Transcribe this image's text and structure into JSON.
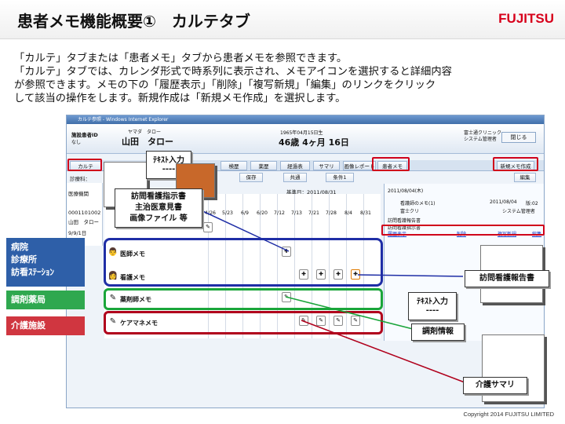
{
  "slide": {
    "title": "患者メモ機能概要①　カルテタブ",
    "logo": "FUJITSU",
    "intro": [
      "「カルテ」タブまたは「患者メモ」タブから患者メモを参照できます。",
      "「カルテ」タブでは、カレンダ形式で時系列に表示され、メモアイコンを選択すると詳細内容",
      "が参照できます。メモの下の「履歴表示」「削除」「複写新規」「編集」のリンクをクリック",
      "して該当の操作をします。新規作成は「新規メモ作成」を選択します。"
    ],
    "copyright": "Copyright 2014 FUJITSU LIMITED"
  },
  "window": {
    "title": "カルテ参照 - Windows Internet Explorer",
    "patient_id_label": "施設患者ID",
    "patient_id_value": "なし",
    "name_kana": "ヤマダ　タロー",
    "name": "山田　タロー",
    "birth": "1965年04月15日生",
    "age": "46歳 4ヶ月 16日",
    "clinic_line1": "富士通クリニック",
    "clinic_line2": "システム管理者",
    "close_label": "閉じる",
    "tabs": [
      "カルテ",
      "検歴",
      "薬歴",
      "経過表",
      "サマリ",
      "画像レポート",
      "患者メモ",
      "新規メモ作成"
    ],
    "toolbar": {
      "date_label": "基準日：2011/08/31",
      "kyotsu": "共通",
      "joken": "条件1",
      "save": "保存",
      "henshu": "編集",
      "kansatsu": "診療科：",
      "iryo": "医療機関"
    },
    "patient_small": [
      "0001101002",
      "山田　タロー",
      "9/9/1日"
    ],
    "dates": [
      "4/26",
      "5/23",
      "6/9",
      "6/20",
      "7/12",
      "7/13",
      "7/21",
      "7/28",
      "8/4",
      "8/31"
    ],
    "rows": [
      "医師メモ",
      "看護メモ",
      "薬剤師メモ",
      "ケアマネメモ"
    ],
    "memo_detail": {
      "header": "2011/08/04(木)",
      "title": "看護師のメモ(1)",
      "date": "2011/08/04",
      "ver": "版:02",
      "author": "富士クリ",
      "author_role": "システム管理者",
      "line1": "訪問看護報告書",
      "line2": "訪問看護指示書",
      "links": [
        "履歴表示",
        "削除",
        "複写新規",
        "編集"
      ]
    }
  },
  "categories": [
    "病院\n診療所\n訪看ｽﾃｰｼｮﾝ",
    "調剤薬局",
    "介護施設"
  ],
  "callouts": {
    "text_input_top": "ﾃｷｽﾄ入力",
    "dashes": "----",
    "attachments": [
      "訪問看護指示書",
      "主治医意見書",
      "画像ファイル 等"
    ],
    "nursing_report": "訪問看護報告書",
    "text_input_right": "ﾃｷｽﾄ入力",
    "pharmacy_info": "調剤情報",
    "care_summary": "介護サマリ"
  },
  "colors": {
    "highlight_red": "#d0021b",
    "nursing_blue": "#1f2ea6",
    "pharmacy_green": "#1aa53a",
    "care_red": "#b0001c"
  }
}
